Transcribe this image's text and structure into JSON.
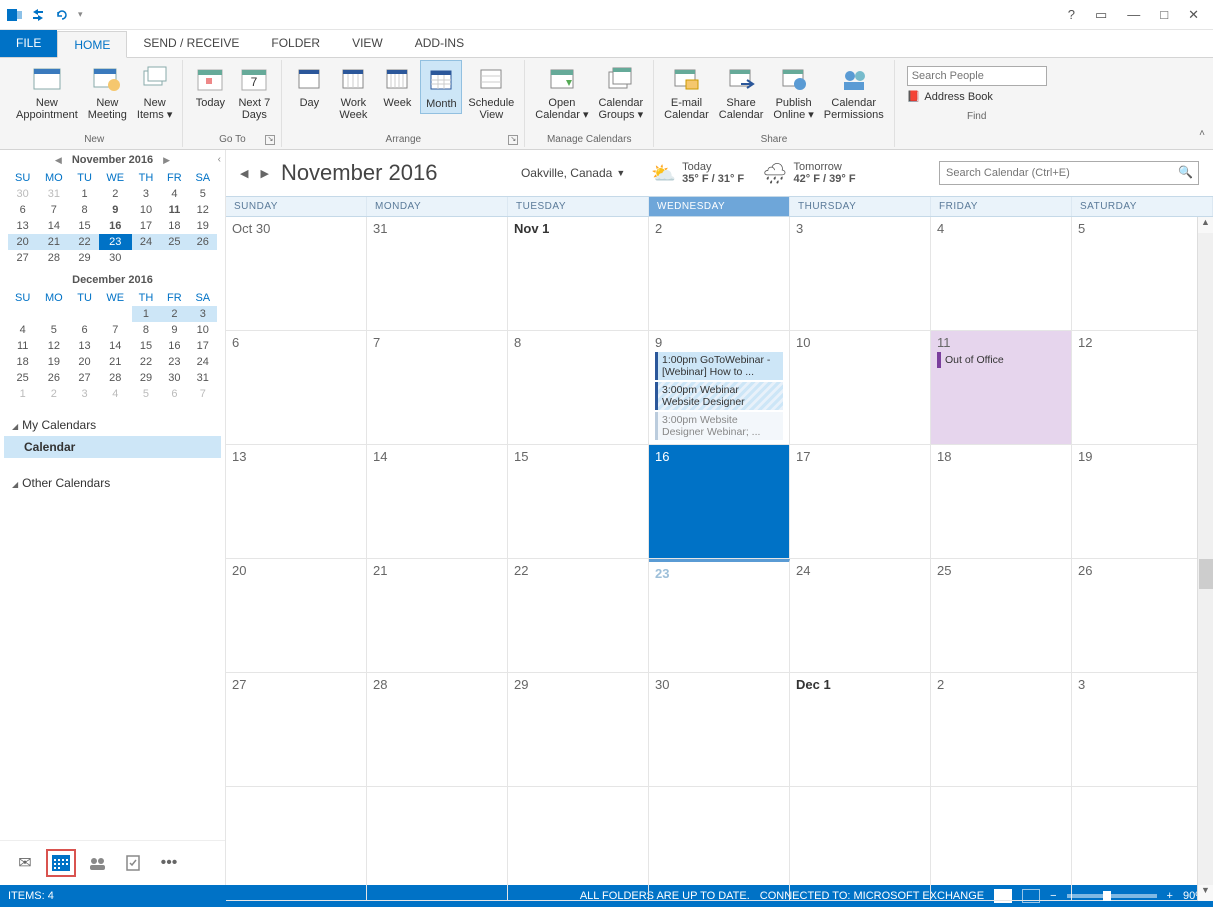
{
  "titlebar": {
    "help": "?",
    "ribbonopt": "▭",
    "min": "—",
    "max": "□",
    "close": "✕"
  },
  "tabs": {
    "file": "FILE",
    "home": "HOME",
    "sendreceive": "SEND / RECEIVE",
    "folder": "FOLDER",
    "view": "VIEW",
    "addins": "ADD-INS"
  },
  "ribbon": {
    "new_appointment": "New\nAppointment",
    "new_meeting": "New\nMeeting",
    "new_items": "New\nItems ▾",
    "today": "Today",
    "next7": "Next 7\nDays",
    "day": "Day",
    "work_week": "Work\nWeek",
    "week": "Week",
    "month": "Month",
    "schedule_view": "Schedule\nView",
    "open_calendar": "Open\nCalendar ▾",
    "calendar_groups": "Calendar\nGroups ▾",
    "email_calendar": "E-mail\nCalendar",
    "share_calendar": "Share\nCalendar",
    "publish_online": "Publish\nOnline ▾",
    "calendar_permissions": "Calendar\nPermissions",
    "search_people_ph": "Search People",
    "address_book": "Address Book",
    "grp_new": "New",
    "grp_goto": "Go To",
    "grp_arrange": "Arrange",
    "grp_manage": "Manage Calendars",
    "grp_share": "Share",
    "grp_find": "Find"
  },
  "minical1": {
    "title": "November 2016",
    "dow": [
      "SU",
      "MO",
      "TU",
      "WE",
      "TH",
      "FR",
      "SA"
    ],
    "rows": [
      [
        {
          "d": "30",
          "o": 1
        },
        {
          "d": "31",
          "o": 1
        },
        {
          "d": "1"
        },
        {
          "d": "2"
        },
        {
          "d": "3"
        },
        {
          "d": "4"
        },
        {
          "d": "5"
        }
      ],
      [
        {
          "d": "6"
        },
        {
          "d": "7"
        },
        {
          "d": "8"
        },
        {
          "d": "9",
          "b": 1
        },
        {
          "d": "10"
        },
        {
          "d": "11",
          "b": 1
        },
        {
          "d": "12"
        }
      ],
      [
        {
          "d": "13"
        },
        {
          "d": "14"
        },
        {
          "d": "15"
        },
        {
          "d": "16",
          "b": 1
        },
        {
          "d": "17"
        },
        {
          "d": "18"
        },
        {
          "d": "19"
        }
      ],
      [
        {
          "d": "20",
          "r": 1
        },
        {
          "d": "21",
          "r": 1
        },
        {
          "d": "22",
          "r": 1
        },
        {
          "d": "23",
          "t": 1
        },
        {
          "d": "24",
          "r": 1
        },
        {
          "d": "25",
          "r": 1
        },
        {
          "d": "26",
          "r": 1
        }
      ],
      [
        {
          "d": "27"
        },
        {
          "d": "28"
        },
        {
          "d": "29"
        },
        {
          "d": "30"
        },
        {
          "d": ""
        },
        {
          "d": ""
        },
        {
          "d": ""
        }
      ]
    ]
  },
  "minical2": {
    "title": "December 2016",
    "dow": [
      "SU",
      "MO",
      "TU",
      "WE",
      "TH",
      "FR",
      "SA"
    ],
    "rows": [
      [
        {
          "d": ""
        },
        {
          "d": ""
        },
        {
          "d": ""
        },
        {
          "d": ""
        },
        {
          "d": "1",
          "r": 1
        },
        {
          "d": "2",
          "r": 1
        },
        {
          "d": "3",
          "r": 1
        }
      ],
      [
        {
          "d": "4"
        },
        {
          "d": "5"
        },
        {
          "d": "6"
        },
        {
          "d": "7"
        },
        {
          "d": "8"
        },
        {
          "d": "9"
        },
        {
          "d": "10"
        }
      ],
      [
        {
          "d": "11"
        },
        {
          "d": "12"
        },
        {
          "d": "13"
        },
        {
          "d": "14"
        },
        {
          "d": "15"
        },
        {
          "d": "16"
        },
        {
          "d": "17"
        }
      ],
      [
        {
          "d": "18"
        },
        {
          "d": "19"
        },
        {
          "d": "20"
        },
        {
          "d": "21"
        },
        {
          "d": "22"
        },
        {
          "d": "23"
        },
        {
          "d": "24"
        }
      ],
      [
        {
          "d": "25"
        },
        {
          "d": "26"
        },
        {
          "d": "27"
        },
        {
          "d": "28"
        },
        {
          "d": "29"
        },
        {
          "d": "30"
        },
        {
          "d": "31"
        }
      ],
      [
        {
          "d": "1",
          "o": 1
        },
        {
          "d": "2",
          "o": 1
        },
        {
          "d": "3",
          "o": 1
        },
        {
          "d": "4",
          "o": 1
        },
        {
          "d": "5",
          "o": 1
        },
        {
          "d": "6",
          "o": 1
        },
        {
          "d": "7",
          "o": 1
        }
      ]
    ]
  },
  "callist": {
    "my_calendars": "My Calendars",
    "calendar": "Calendar",
    "other": "Other Calendars"
  },
  "calhead": {
    "title": "November 2016",
    "location": "Oakville, Canada",
    "today_label": "Today",
    "today_temp": "35° F / 31° F",
    "tomorrow_label": "Tomorrow",
    "tomorrow_temp": "42° F / 39° F",
    "search_ph": "Search Calendar (Ctrl+E)"
  },
  "dow": [
    "SUNDAY",
    "MONDAY",
    "TUESDAY",
    "WEDNESDAY",
    "THURSDAY",
    "FRIDAY",
    "SATURDAY"
  ],
  "cells": [
    [
      {
        "d": "Oct 30"
      },
      {
        "d": "31"
      },
      {
        "d": "Nov 1",
        "b": 1
      },
      {
        "d": "2"
      },
      {
        "d": "3"
      },
      {
        "d": "4"
      },
      {
        "d": "5"
      }
    ],
    [
      {
        "d": "6"
      },
      {
        "d": "7"
      },
      {
        "d": "8"
      },
      {
        "d": "9",
        "ev": [
          {
            "t": "1:00pm GoToWebinar - [Webinar] How to ...",
            "cls": ""
          },
          {
            "t": "3:00pm Webinar Website Designer",
            "cls": "tentative"
          },
          {
            "t": "3:00pm Website Designer Webinar; ...",
            "cls": "light"
          }
        ]
      },
      {
        "d": "10"
      },
      {
        "d": "11",
        "ev": [
          {
            "t": "Out of Office",
            "cls": "oof"
          }
        ],
        "oofcell": 1
      },
      {
        "d": "12"
      }
    ],
    [
      {
        "d": "13"
      },
      {
        "d": "14"
      },
      {
        "d": "15"
      },
      {
        "d": "16",
        "sel": 1
      },
      {
        "d": "17"
      },
      {
        "d": "18"
      },
      {
        "d": "19"
      }
    ],
    [
      {
        "d": "20"
      },
      {
        "d": "21"
      },
      {
        "d": "22"
      },
      {
        "d": "23",
        "faded": 1,
        "today": 1
      },
      {
        "d": "24"
      },
      {
        "d": "25"
      },
      {
        "d": "26"
      }
    ],
    [
      {
        "d": "27"
      },
      {
        "d": "28"
      },
      {
        "d": "29"
      },
      {
        "d": "30"
      },
      {
        "d": "Dec 1",
        "b": 1
      },
      {
        "d": "2"
      },
      {
        "d": "3"
      }
    ],
    [
      {
        "d": ""
      },
      {
        "d": ""
      },
      {
        "d": ""
      },
      {
        "d": ""
      },
      {
        "d": ""
      },
      {
        "d": ""
      },
      {
        "d": ""
      }
    ]
  ],
  "status": {
    "items": "ITEMS: 4",
    "folders": "ALL FOLDERS ARE UP TO DATE.",
    "connected": "CONNECTED TO: MICROSOFT EXCHANGE",
    "zoom": "90%"
  }
}
